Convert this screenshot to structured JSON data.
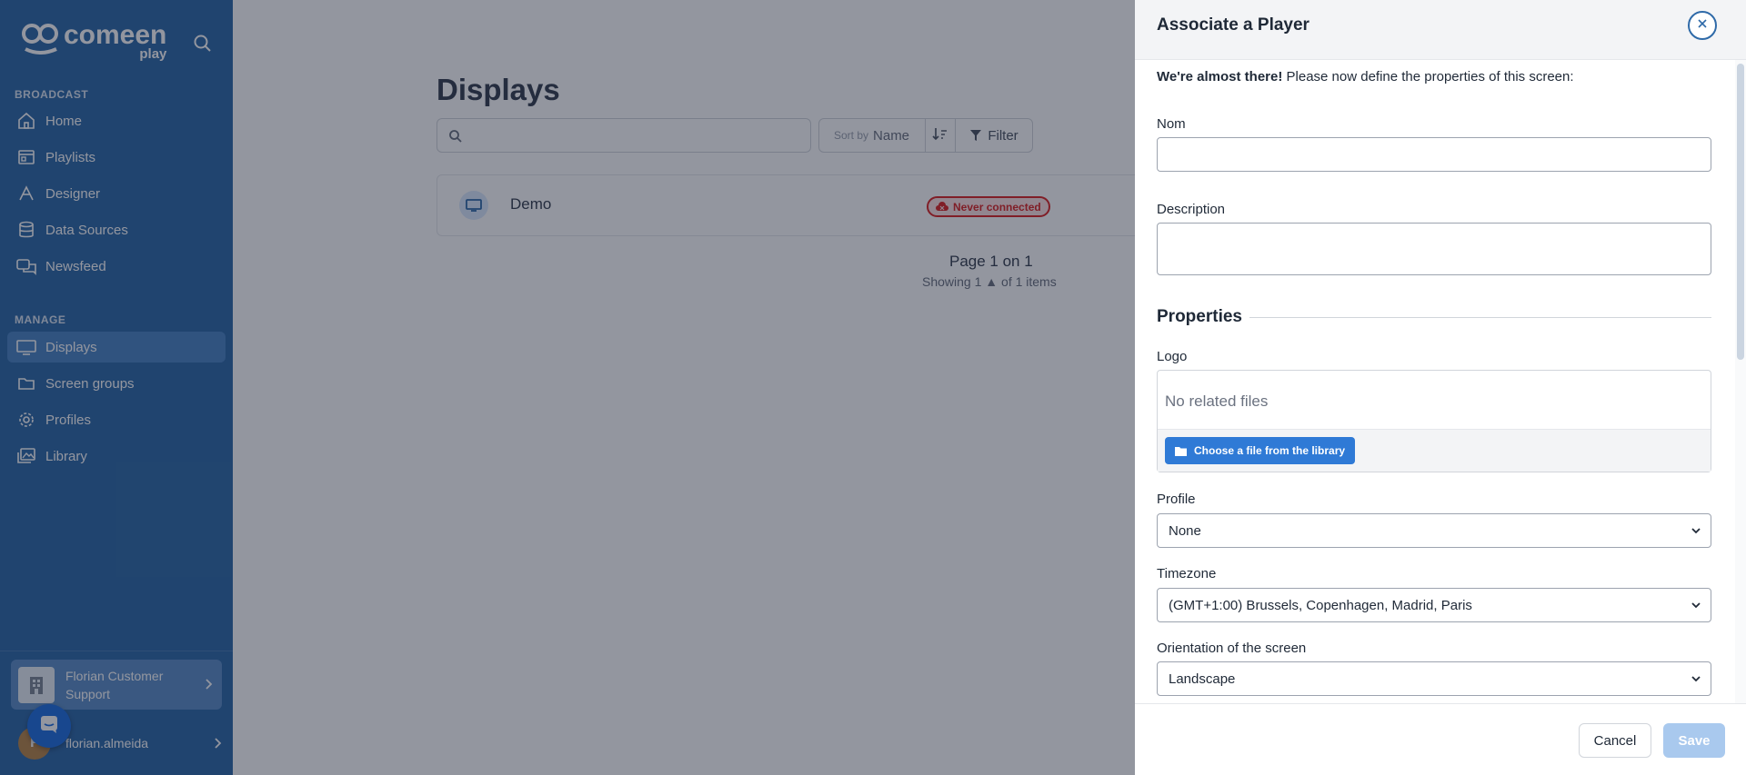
{
  "sidebar": {
    "logo": {
      "name": "comeen",
      "sub": "play"
    },
    "sections": [
      {
        "title": "BROADCAST"
      },
      {
        "title": "MANAGE"
      }
    ],
    "items": [
      {
        "label": "Home",
        "icon": "home-icon"
      },
      {
        "label": "Playlists",
        "icon": "playlist-icon"
      },
      {
        "label": "Designer",
        "icon": "designer-icon"
      },
      {
        "label": "Data Sources",
        "icon": "database-icon"
      },
      {
        "label": "Newsfeed",
        "icon": "newsfeed-icon"
      },
      {
        "label": "Displays",
        "icon": "monitor-icon",
        "active": true
      },
      {
        "label": "Screen groups",
        "icon": "folder-icon"
      },
      {
        "label": "Profiles",
        "icon": "gear-icon"
      },
      {
        "label": "Library",
        "icon": "library-icon"
      }
    ],
    "organization": {
      "label": "Florian Customer Support"
    },
    "user": {
      "initial": "F",
      "name": "florian.almeida"
    }
  },
  "main": {
    "title": "Displays",
    "search": {
      "value": "",
      "placeholder": ""
    },
    "sort": {
      "prefix": "Sort by",
      "value": "Name"
    },
    "filter_label": "Filter",
    "displays": [
      {
        "name": "Demo",
        "status": "Never connected"
      }
    ],
    "pagination": {
      "page_info": "Page 1 on 1",
      "showing_prefix": "Showing 1",
      "showing_suffix": "of 1 items"
    }
  },
  "modal": {
    "title": "Associate a Player",
    "intro_bold": "We're almost there!",
    "intro_rest": " Please now define the properties of this screen:",
    "fields": {
      "name_label": "Nom",
      "name_value": "",
      "description_label": "Description",
      "description_value": ""
    },
    "properties_heading": "Properties",
    "logo": {
      "label": "Logo",
      "empty_text": "No related files",
      "choose_button": "Choose a file from the library"
    },
    "profile": {
      "label": "Profile",
      "selected": "None"
    },
    "timezone": {
      "label": "Timezone",
      "selected": "(GMT+1:00) Brussels, Copenhagen, Madrid, Paris"
    },
    "orientation": {
      "label": "Orientation of the screen",
      "selected": "Landscape"
    },
    "cancel_label": "Cancel",
    "save_label": "Save"
  },
  "colors": {
    "sidebar_bg": "#2f6aa8",
    "accent": "#2f7ad6",
    "status_red": "#dc2626",
    "save_disabled": "#a9c9ee"
  }
}
